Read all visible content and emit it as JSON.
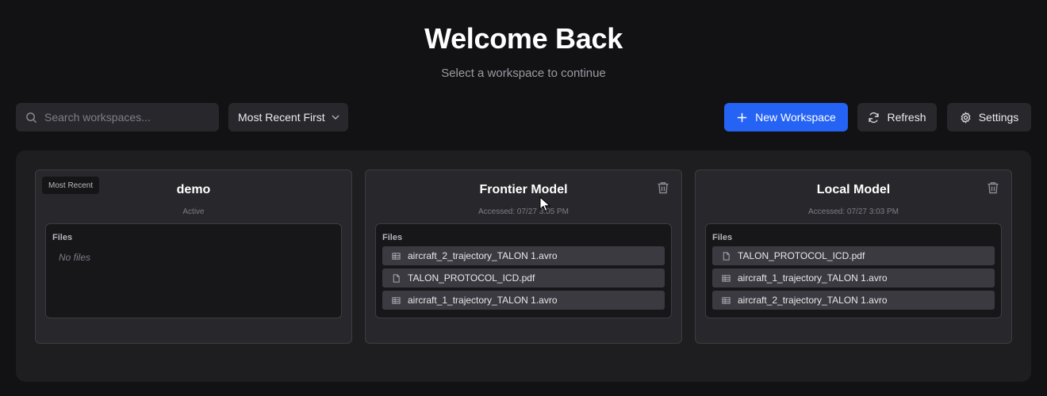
{
  "header": {
    "title": "Welcome Back",
    "subtitle": "Select a workspace to continue"
  },
  "toolbar": {
    "search_placeholder": "Search workspaces...",
    "sort_value": "Most Recent First",
    "new_label": "New Workspace",
    "refresh_label": "Refresh",
    "settings_label": "Settings"
  },
  "colors": {
    "background": "#121214",
    "panel": "#1e1e21",
    "card": "#28282c",
    "accent": "#2563f5"
  },
  "icons": {
    "search": "search-icon",
    "sort": "chevron-down-icon",
    "new": "plus-icon",
    "refresh": "refresh-icon",
    "settings": "gear-icon",
    "delete": "trash-icon",
    "table_file": "table-icon",
    "doc_file": "document-icon"
  },
  "files_label": "Files",
  "workspaces": [
    {
      "name": "demo",
      "badge": "Most Recent",
      "meta": "Active",
      "empty_text": "No files",
      "files": []
    },
    {
      "name": "Frontier Model",
      "meta": "Accessed: 07/27 3:05 PM",
      "files": [
        {
          "name": "aircraft_2_trajectory_TALON 1.avro",
          "icon": "table-icon"
        },
        {
          "name": "TALON_PROTOCOL_ICD.pdf",
          "icon": "document-icon"
        },
        {
          "name": "aircraft_1_trajectory_TALON 1.avro",
          "icon": "table-icon"
        }
      ]
    },
    {
      "name": "Local Model",
      "meta": "Accessed: 07/27 3:03 PM",
      "files": [
        {
          "name": "TALON_PROTOCOL_ICD.pdf",
          "icon": "document-icon"
        },
        {
          "name": "aircraft_1_trajectory_TALON 1.avro",
          "icon": "table-icon"
        },
        {
          "name": "aircraft_2_trajectory_TALON 1.avro",
          "icon": "table-icon"
        }
      ]
    }
  ]
}
